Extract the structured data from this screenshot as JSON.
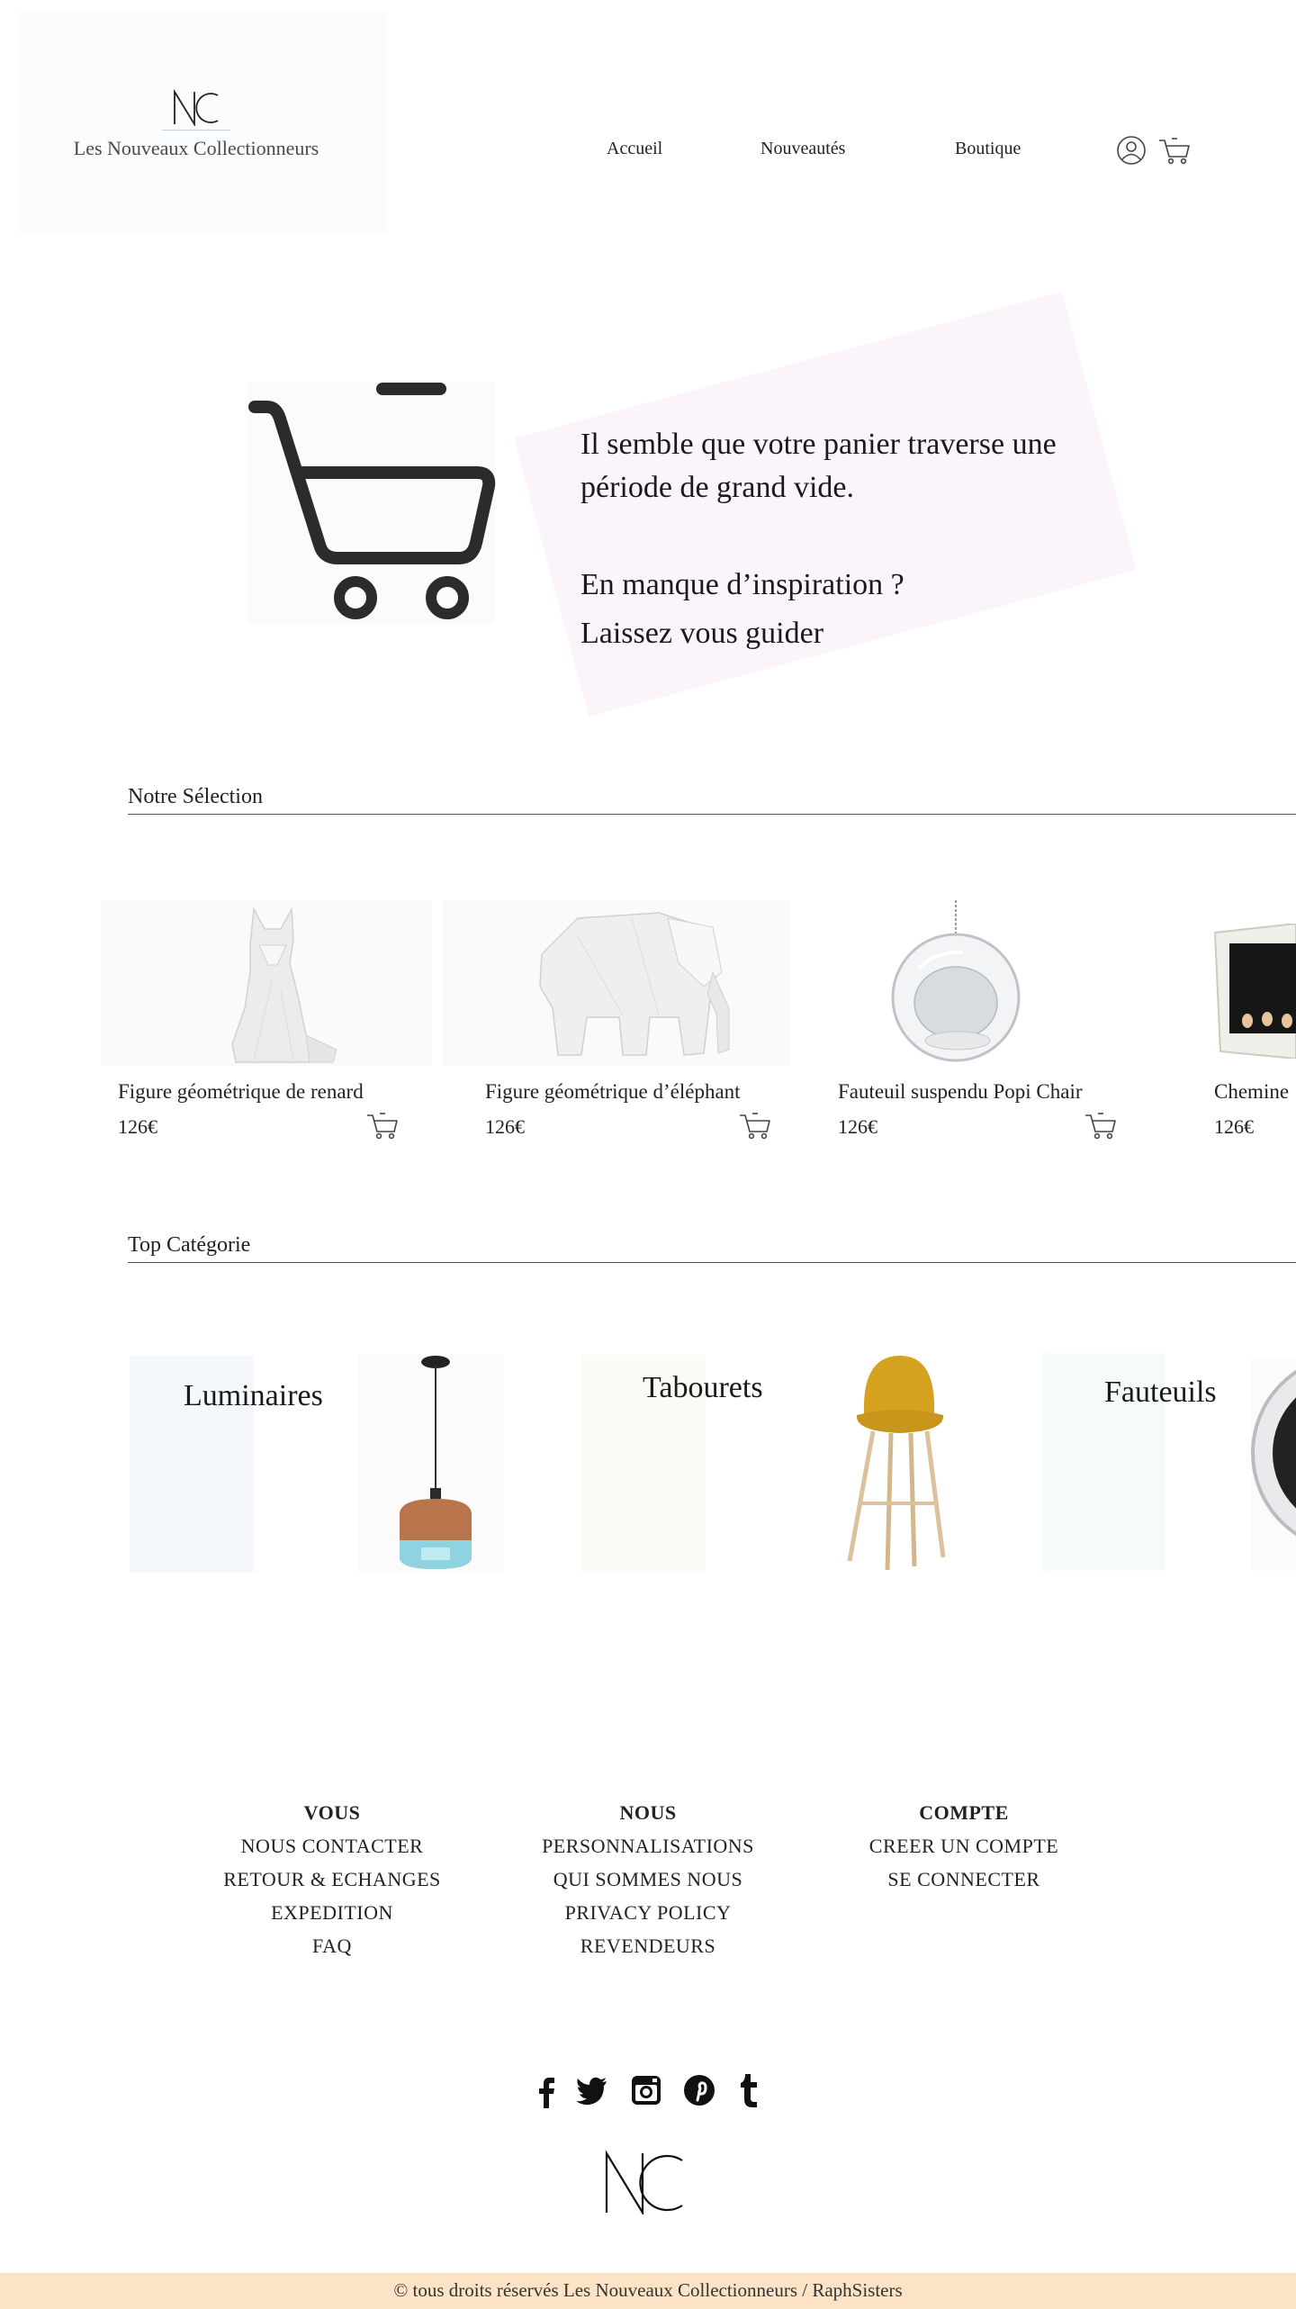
{
  "header": {
    "brand_name": "Les Nouveaux Collectionneurs",
    "logo_letters": "NC",
    "nav": {
      "home": "Accueil",
      "new": "Nouveautés",
      "shop": "Boutique"
    }
  },
  "hero": {
    "line1": "Il semble que votre panier traverse une",
    "line2": "période de grand vide.",
    "line3": "En manque d’inspiration ?",
    "line4": "Laissez vous guider"
  },
  "selection": {
    "title": "Notre Sélection",
    "products": [
      {
        "name": "Figure géométrique de renard",
        "price": "126€"
      },
      {
        "name": "Figure géométrique d’éléphant",
        "price": "126€"
      },
      {
        "name": "Fauteuil suspendu Popi Chair",
        "price": "126€"
      },
      {
        "name": "Chemine",
        "price": "126€"
      }
    ]
  },
  "categories": {
    "title": "Top Catégorie",
    "items": [
      {
        "label": "Luminaires"
      },
      {
        "label": "Tabourets"
      },
      {
        "label": "Fauteuils"
      }
    ]
  },
  "footer": {
    "vous": {
      "head": "VOUS",
      "links": [
        "NOUS CONTACTER",
        "RETOUR & ECHANGES",
        "EXPEDITION",
        "FAQ"
      ]
    },
    "nous": {
      "head": "NOUS",
      "links": [
        "PERSONNALISATIONS",
        "QUI SOMMES NOUS",
        "PRIVACY POLICY",
        "REVENDEURS"
      ]
    },
    "compte": {
      "head": "COMPTE",
      "links": [
        "CREER UN COMPTE",
        "SE CONNECTER"
      ]
    },
    "social_icons": [
      "facebook-icon",
      "twitter-icon",
      "instagram-icon",
      "pinterest-icon",
      "tumblr-icon"
    ],
    "copyright": "© tous droits réservés Les Nouveaux Collectionneurs / RaphSisters"
  },
  "colors": {
    "hero_pink": "#fbf4fa",
    "copyright_bar": "#fde3c6",
    "lamp_copper": "#b8744a",
    "lamp_glass": "#8fd3e0",
    "stool_mustard": "#d4a21f"
  }
}
